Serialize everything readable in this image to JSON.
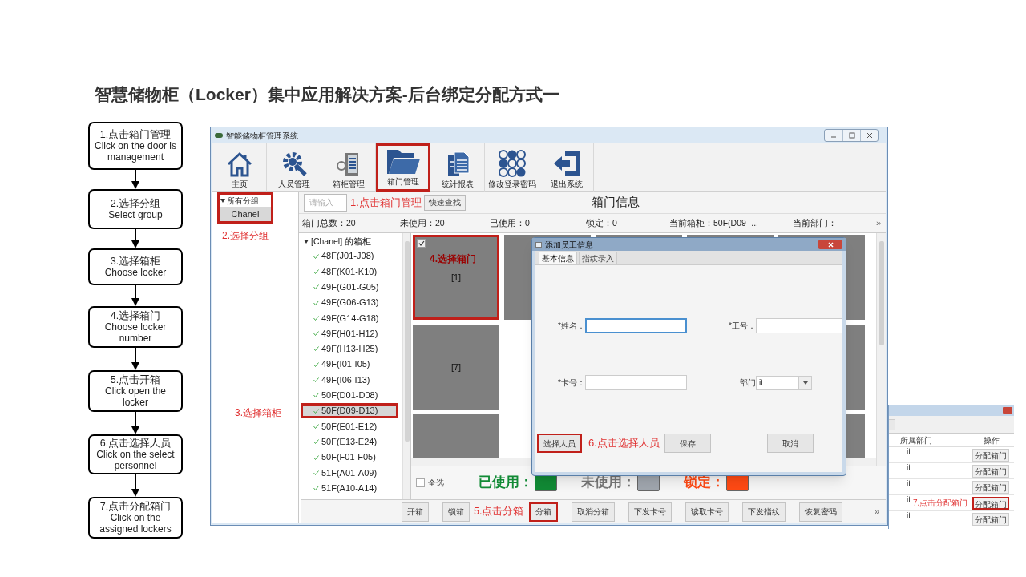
{
  "slide_title": "智慧储物柜（Locker）集中应用解决方案-后台绑定分配方式一",
  "flow_steps": [
    {
      "title": "1.点击箱门管理",
      "subtitle": "Click on the door is management"
    },
    {
      "title": "2.选择分组",
      "subtitle": "Select group"
    },
    {
      "title": "3.选择箱柜",
      "subtitle": "Choose locker"
    },
    {
      "title": "4.选择箱门",
      "subtitle": "Choose locker number"
    },
    {
      "title": "5.点击开箱",
      "subtitle": "Click open the locker"
    },
    {
      "title": "6.点击选择人员",
      "subtitle": "Click on the select personnel"
    },
    {
      "title": "7.点击分配箱门",
      "subtitle": "Click on the assigned lockers"
    }
  ],
  "window": {
    "title": "智能储物柜管理系统",
    "toolbar": [
      {
        "label": "主页",
        "kind": "home",
        "highlighted": false
      },
      {
        "label": "人员管理",
        "kind": "gear",
        "highlighted": false
      },
      {
        "label": "箱柜管理",
        "kind": "server",
        "highlighted": false
      },
      {
        "label": "箱门管理",
        "kind": "folder",
        "highlighted": true
      },
      {
        "label": "统计报表",
        "kind": "documents",
        "highlighted": false
      },
      {
        "label": "修改登录密码",
        "kind": "keypad",
        "highlighted": false
      },
      {
        "label": "退出系统",
        "kind": "exit",
        "highlighted": false
      }
    ],
    "sidebar": {
      "highlighted": true,
      "note": "2.选择分组",
      "items": [
        {
          "label": "所有分组",
          "expanded": true,
          "children": [
            {
              "label": "Chanel",
              "selected": true
            }
          ]
        }
      ]
    },
    "search": {
      "placeholder": "请输入",
      "button": "快速查找",
      "note": "1.点击箱门管理"
    },
    "heading": "箱门信息",
    "stats": [
      "箱门总数：20",
      "未使用：20",
      "已使用：0",
      "锁定：0",
      "当前箱柜：50F(D09- ...",
      "当前部门："
    ],
    "stats_more": "»",
    "tree": {
      "note": "3.选择箱柜",
      "label": "[Chanel] 的箱柜",
      "expanded": true,
      "children": [
        {
          "label": "48F(J01-J08)",
          "selected": false
        },
        {
          "label": "48F(K01-K10)",
          "selected": false
        },
        {
          "label": "49F(G01-G05)",
          "selected": false
        },
        {
          "label": "49F(G06-G13)",
          "selected": false
        },
        {
          "label": "49F(G14-G18)",
          "selected": false
        },
        {
          "label": "49F(H01-H12)",
          "selected": false
        },
        {
          "label": "49F(H13-H25)",
          "selected": false
        },
        {
          "label": "49F(I01-I05)",
          "selected": false
        },
        {
          "label": "49F(I06-I13)",
          "selected": false
        },
        {
          "label": "50F(D01-D08)",
          "selected": false
        },
        {
          "label": "50F(D09-D13)",
          "selected": true
        },
        {
          "label": "50F(E01-E12)",
          "selected": false
        },
        {
          "label": "50F(E13-E24)",
          "selected": false
        },
        {
          "label": "50F(F01-F05)",
          "selected": false
        },
        {
          "label": "51F(A01-A09)",
          "selected": false
        },
        {
          "label": "51F(A10-A14)",
          "selected": false
        }
      ]
    },
    "grid": {
      "note": "4.选择箱门",
      "cells": [
        {
          "label": "[1]",
          "checked": true,
          "highlighted": true
        },
        {
          "label": "[7]",
          "checked": false,
          "highlighted": false
        }
      ]
    },
    "select_all": {
      "label": "全选",
      "checked": false
    },
    "legend": [
      {
        "label": "已使用：",
        "color": "#118a35"
      },
      {
        "label": "未使用：",
        "color": "#a0a6ae"
      },
      {
        "label": "锁定：",
        "color": "#ff4a14"
      }
    ],
    "actions": [
      {
        "label": "开箱",
        "highlighted": false
      },
      {
        "label": "锁箱",
        "highlighted": false
      },
      {
        "label": "分箱",
        "highlighted": true
      },
      {
        "label": "取消分箱",
        "highlighted": false
      },
      {
        "label": "下发卡号",
        "highlighted": false
      },
      {
        "label": "读取卡号",
        "highlighted": false
      },
      {
        "label": "下发指纹",
        "highlighted": false
      },
      {
        "label": "恢复密码",
        "highlighted": false
      }
    ],
    "actions_note": "5.点击分箱",
    "actions_more": "»",
    "dialog": {
      "title": "添加员工信息",
      "tabs": [
        {
          "label": "基本信息",
          "selected": true
        },
        {
          "label": "指纹录入",
          "selected": false
        }
      ],
      "fields": [
        {
          "label": "*姓名：",
          "kind": "text",
          "focused": true
        },
        {
          "label": "*工号：",
          "kind": "text",
          "focused": false
        },
        {
          "label": "*卡号：",
          "kind": "text",
          "focused": false
        },
        {
          "label": "部门",
          "kind": "select",
          "value": "it",
          "focused": false
        }
      ],
      "buttons": [
        {
          "label": "选择人员",
          "highlighted": true
        },
        {
          "label": "保存",
          "highlighted": false
        },
        {
          "label": "取消",
          "highlighted": false
        }
      ],
      "note": "6.点击选择人员"
    }
  },
  "side_panel": {
    "columns": [
      "所属部门",
      "操作"
    ],
    "note": "7.点击分配箱门",
    "rows": [
      {
        "department": "it",
        "action": "分配箱门",
        "highlighted": false
      },
      {
        "department": "it",
        "action": "分配箱门",
        "highlighted": false
      },
      {
        "department": "it",
        "action": "分配箱门",
        "highlighted": false
      },
      {
        "department": "it",
        "action": "分配箱门",
        "highlighted": true
      },
      {
        "department": "it",
        "action": "分配箱门",
        "highlighted": false
      }
    ]
  }
}
